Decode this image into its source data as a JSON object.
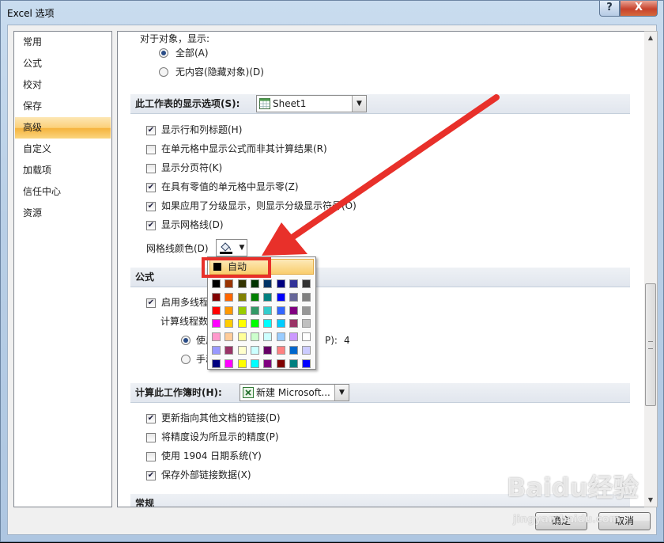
{
  "window": {
    "title": "Excel 选项",
    "help_glyph": "?",
    "close_glyph": "X"
  },
  "nav": {
    "items": [
      "常用",
      "公式",
      "校对",
      "保存",
      "高级",
      "自定义",
      "加载项",
      "信任中心",
      "资源"
    ],
    "selected_index": 4
  },
  "objects_section": {
    "label": "对于对象，显示:",
    "option_all": "全部(A)",
    "option_none": "无内容(隐藏对象)(D)",
    "selected": "all"
  },
  "sheet_section": {
    "label": "此工作表的显示选项(S):",
    "sheet_value": "Sheet1",
    "options": [
      {
        "label": "显示行和列标题(H)",
        "checked": true
      },
      {
        "label": "在单元格中显示公式而非其计算结果(R)",
        "checked": false
      },
      {
        "label": "显示分页符(K)",
        "checked": false
      },
      {
        "label": "在具有零值的单元格中显示零(Z)",
        "checked": true
      },
      {
        "label": "如果应用了分级显示，则显示分级显示符号(O)",
        "checked": true
      },
      {
        "label": "显示网格线(D)",
        "checked": true
      }
    ],
    "gridline_color_label": "网格线颜色(D)"
  },
  "formula_section": {
    "label": "公式",
    "multithread_label": "启用多线程计",
    "multithread_checked": true,
    "threads_label": "计算线程数",
    "use_label": "使用",
    "use_suffix": "P):",
    "thread_count": "4",
    "manual_label": "手动"
  },
  "workbook_section": {
    "label": "计算此工作簿时(H):",
    "workbook_value": "新建 Microsoft...",
    "options": [
      {
        "label": "更新指向其他文档的链接(D)",
        "checked": true
      },
      {
        "label": "将精度设为所显示的精度(P)",
        "checked": false
      },
      {
        "label": "使用 1904 日期系统(Y)",
        "checked": false
      },
      {
        "label": "保存外部链接数据(X)",
        "checked": true
      }
    ]
  },
  "general_section": {
    "label": "常规"
  },
  "color_dropdown": {
    "auto_label": "自动",
    "auto_color": "#000000",
    "colors": [
      [
        "#000000",
        "#993300",
        "#333300",
        "#003300",
        "#003366",
        "#000080",
        "#333399",
        "#333333"
      ],
      [
        "#800000",
        "#ff6600",
        "#808000",
        "#008000",
        "#008080",
        "#0000ff",
        "#666699",
        "#808080"
      ],
      [
        "#ff0000",
        "#ff9900",
        "#99cc00",
        "#339966",
        "#33cccc",
        "#3366ff",
        "#800080",
        "#969696"
      ],
      [
        "#ff00ff",
        "#ffcc00",
        "#ffff00",
        "#00ff00",
        "#00ffff",
        "#00ccff",
        "#993366",
        "#c0c0c0"
      ],
      [
        "#ff99cc",
        "#ffcc99",
        "#ffff99",
        "#ccffcc",
        "#ccffff",
        "#99ccff",
        "#cc99ff",
        "#ffffff"
      ],
      [
        "#9999ff",
        "#993366",
        "#ffffcc",
        "#ccffff",
        "#660066",
        "#ff8080",
        "#0066cc",
        "#ccccff"
      ],
      [
        "#000080",
        "#ff00ff",
        "#ffff00",
        "#00ffff",
        "#800080",
        "#800000",
        "#008080",
        "#0000ff"
      ]
    ]
  },
  "buttons": {
    "ok": "确定",
    "cancel": "取消"
  },
  "watermark": {
    "brand": "Baidu经验",
    "url": "jingyan.baidu.com"
  },
  "annotation": {
    "arrow_color": "#e8302a"
  }
}
